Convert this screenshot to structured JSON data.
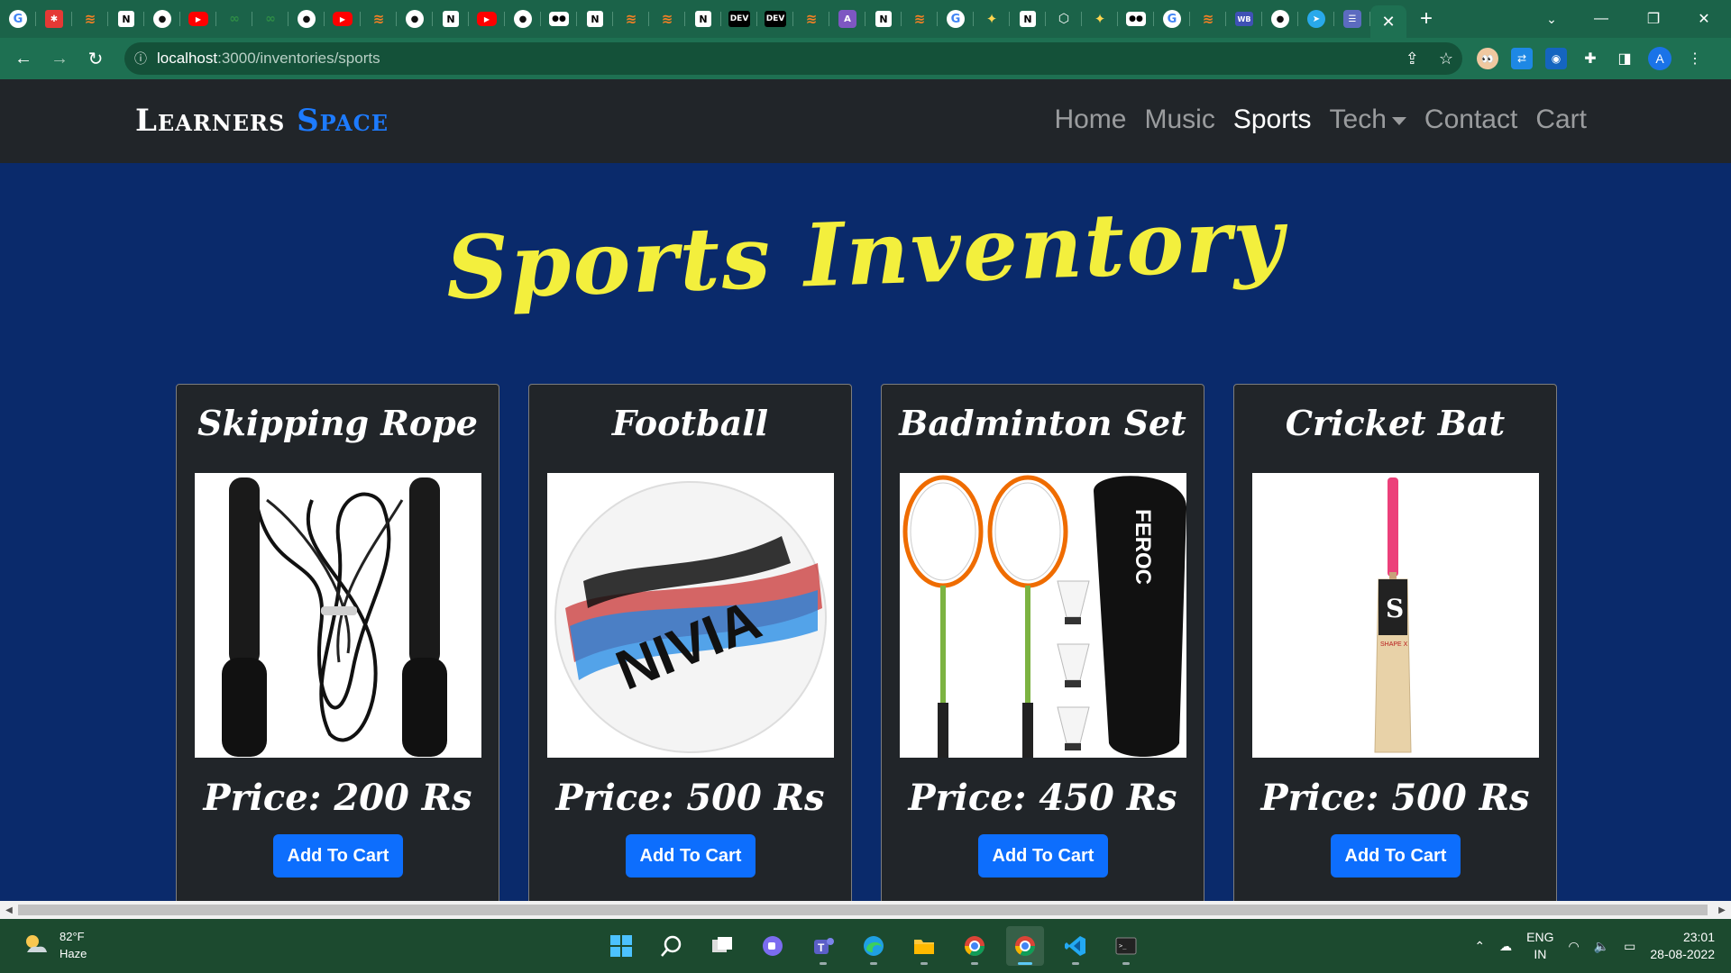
{
  "browser": {
    "tabs": [
      "google",
      "gear",
      "so",
      "notion",
      "gh",
      "yt",
      "gfg",
      "gfg",
      "gh",
      "yt",
      "so",
      "gh",
      "notion",
      "yt",
      "gh",
      "medium",
      "notion",
      "so",
      "so",
      "notion",
      "dev",
      "dev",
      "so",
      "a",
      "notion",
      "so",
      "google",
      "sparkle",
      "notion",
      "cube",
      "sparkle",
      "medium",
      "google",
      "so",
      "wb",
      "gh",
      "tg",
      "lin"
    ],
    "active_tab_close": "✕",
    "new_tab": "+",
    "url_host": "localhost",
    "url_path": ":3000/inventories/sports",
    "profile_initial": "A"
  },
  "navbar": {
    "brand_first": "Learners",
    "brand_second": "Space",
    "links": {
      "home": "Home",
      "music": "Music",
      "sports": "Sports",
      "tech": "Tech",
      "contact": "Contact",
      "cart": "Cart"
    }
  },
  "page": {
    "title": "Sports Inventory",
    "products": [
      {
        "name": "Skipping Rope",
        "price": "Price: 200 Rs",
        "button": "Add To Cart"
      },
      {
        "name": "Football",
        "price": "Price: 500 Rs",
        "button": "Add To Cart"
      },
      {
        "name": "Badminton Set",
        "price": "Price: 450 Rs",
        "button": "Add To Cart"
      },
      {
        "name": "Cricket Bat",
        "price": "Price: 500 Rs",
        "button": "Add To Cart"
      }
    ]
  },
  "product_images": {
    "ball_brand": "NIVIA",
    "bag_brand": "FEROC",
    "bat_brand": "SHAPE X"
  },
  "taskbar": {
    "temperature": "82°F",
    "condition": "Haze",
    "lang_top": "ENG",
    "lang_bottom": "IN",
    "time": "23:01",
    "date": "28-08-2022"
  },
  "colors": {
    "page_bg": "#0a2a6b",
    "title_yellow": "#f3ef3d",
    "brand_blue": "#1d7bff",
    "button_blue": "#0d6efd",
    "navbar": "#212529",
    "chrome_green": "#1e7052"
  }
}
